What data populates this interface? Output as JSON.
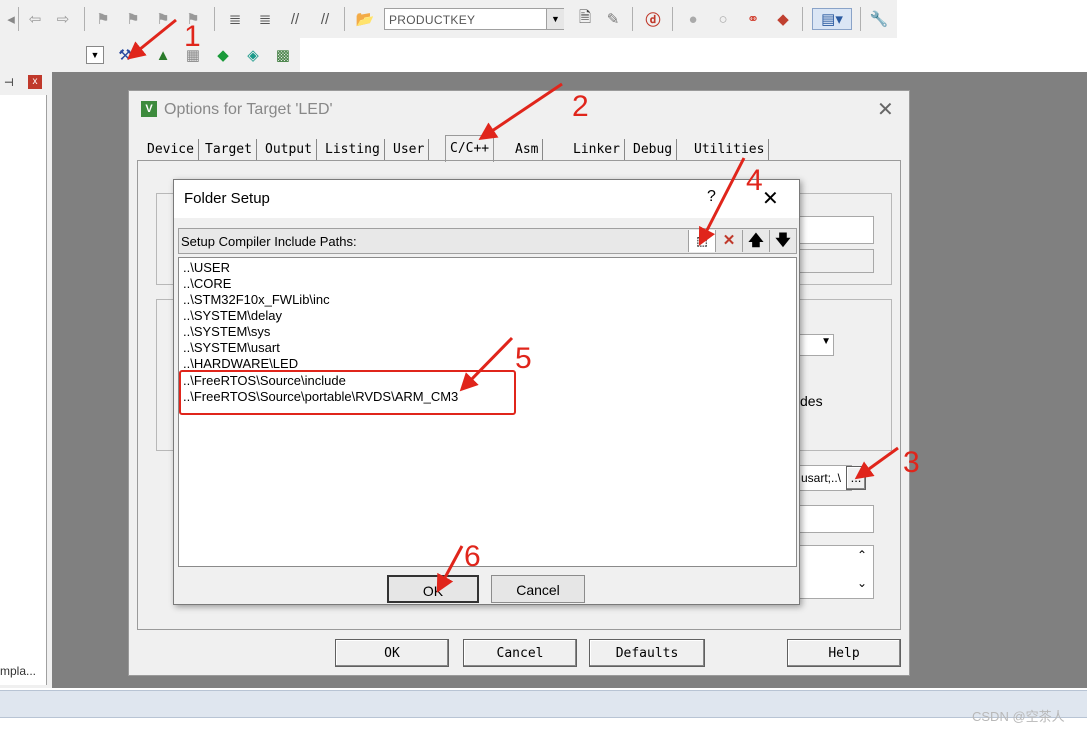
{
  "toolbar": {
    "target_box": "PRODUCTKEY",
    "icons_row1": [
      "back-arrow-icon",
      "forward-arrow-icon",
      "bookmark-icon",
      "bookmark-prev-icon",
      "bookmark-next-icon",
      "bookmark-clear-icon",
      "indent-icon",
      "unindent-icon",
      "comment-icon",
      "uncomment-icon",
      "open-file-icon",
      "find-in-files-icon",
      "find-icon",
      "debug-icon",
      "breakpoint-icon",
      "breakpoint-disable-icon",
      "breakpoint-kill-icon",
      "breakpoint-clear-icon",
      "view-window-icon",
      "configure-icon"
    ],
    "icons_row2": [
      "dropdown-icon",
      "target-options-icon",
      "manage-components-icon",
      "file-extensions-icon",
      "select-packs-icon",
      "pack-installer-icon",
      "manage-rte-icon"
    ]
  },
  "left_panel": {
    "pin": "←",
    "close": "x",
    "bottom_label": "mpla..."
  },
  "options_dialog": {
    "title": "Options for Target 'LED'",
    "icon_glyph": "V",
    "close": "✕",
    "tabs": [
      "Device",
      "Target",
      "Output",
      "Listing",
      "User",
      "C/C++",
      "Asm",
      "Linker",
      "Debug",
      "Utilities"
    ],
    "partial_text_modes": "des",
    "partial_text_include": "usart;..\\",
    "browse_button": "...",
    "buttons": {
      "ok": "OK",
      "cancel": "Cancel",
      "defaults": "Defaults",
      "help": "Help"
    }
  },
  "folder_setup": {
    "title": "Folder Setup",
    "help": "?",
    "close": "✕",
    "header_label": "Setup Compiler Include Paths:",
    "paths": [
      "..\\USER",
      "..\\CORE",
      "..\\STM32F10x_FWLib\\inc",
      "..\\SYSTEM\\delay",
      "..\\SYSTEM\\sys",
      "..\\SYSTEM\\usart",
      "..\\HARDWARE\\LED",
      "..\\FreeRTOS\\Source\\include",
      "..\\FreeRTOS\\Source\\portable\\RVDS\\ARM_CM3"
    ],
    "buttons": {
      "ok": "OK",
      "cancel": "Cancel"
    }
  },
  "annotations": [
    "1",
    "2",
    "3",
    "4",
    "5",
    "6"
  ],
  "watermark": "CSDN @空茶人",
  "colors": {
    "annotation": "#e0251b"
  }
}
